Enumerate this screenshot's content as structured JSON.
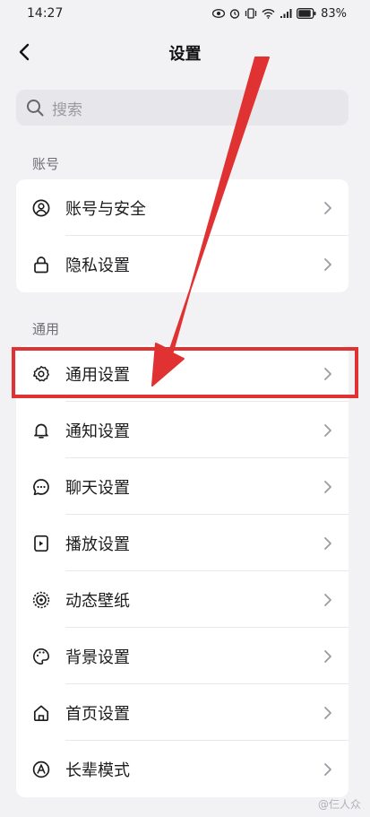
{
  "status_bar": {
    "time": "14:27",
    "battery": "83%"
  },
  "header": {
    "title": "设置"
  },
  "search": {
    "placeholder": "搜索"
  },
  "sections": [
    {
      "label": "账号",
      "items": [
        {
          "label": "账号与安全",
          "icon": "account-icon"
        },
        {
          "label": "隐私设置",
          "icon": "lock-icon"
        }
      ]
    },
    {
      "label": "通用",
      "items": [
        {
          "label": "通用设置",
          "icon": "gear-icon",
          "highlighted": true
        },
        {
          "label": "通知设置",
          "icon": "bell-icon"
        },
        {
          "label": "聊天设置",
          "icon": "chat-icon"
        },
        {
          "label": "播放设置",
          "icon": "play-icon"
        },
        {
          "label": "动态壁纸",
          "icon": "wallpaper-icon"
        },
        {
          "label": "背景设置",
          "icon": "palette-icon"
        },
        {
          "label": "首页设置",
          "icon": "home-icon"
        },
        {
          "label": "长辈模式",
          "icon": "elder-mode-icon"
        }
      ]
    }
  ],
  "annotation": {
    "highlight_color": "#e03232"
  },
  "watermark": "@仨人众"
}
